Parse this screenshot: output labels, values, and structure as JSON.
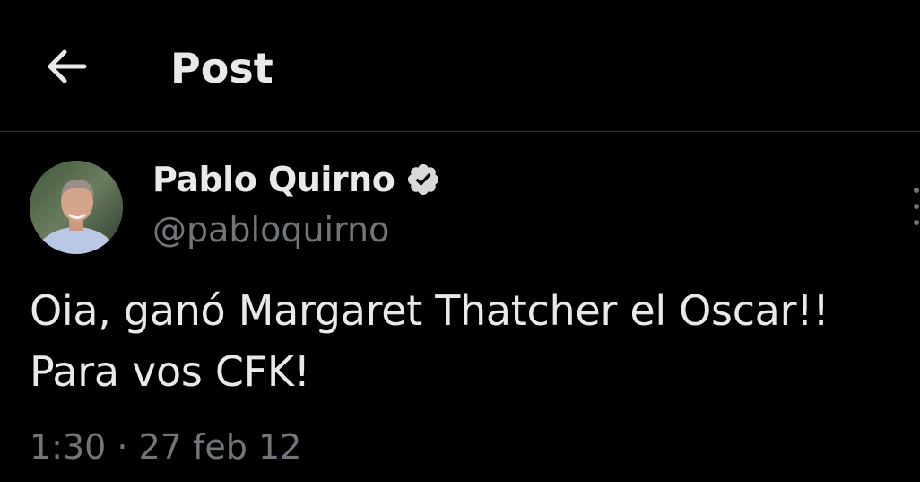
{
  "header": {
    "back_icon": "arrow-left-icon",
    "title": "Post"
  },
  "post": {
    "author": {
      "name": "Pablo Quirno",
      "handle": "@pabloquirno",
      "verified": true,
      "verified_icon": "verified-badge-icon"
    },
    "text": "Oia, ganó Margaret Thatcher el Oscar!!\nPara vos CFK!",
    "time": "1:30",
    "separator": " · ",
    "date": "27 feb 12",
    "more_icon": "more-options-icon"
  },
  "colors": {
    "background": "#000000",
    "primary_text": "#e7e9ea",
    "secondary_text": "#71767b",
    "divider": "#2f3336",
    "verified_badge": "#d9d9d9"
  }
}
